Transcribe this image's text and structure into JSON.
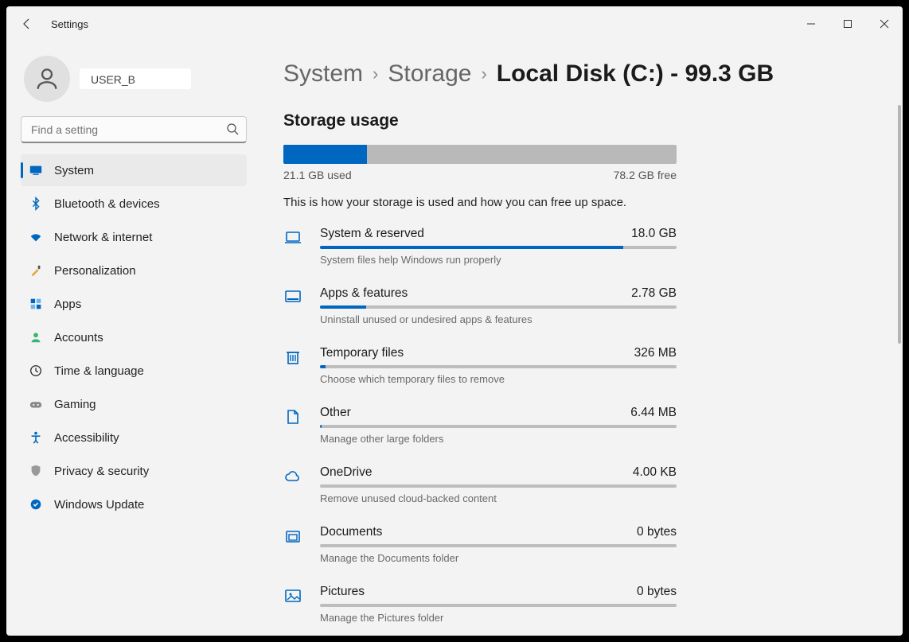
{
  "app_title": "Settings",
  "user": {
    "name": "USER_B"
  },
  "search": {
    "placeholder": "Find a setting"
  },
  "nav": {
    "items": [
      {
        "label": "System",
        "icon": "system",
        "selected": true
      },
      {
        "label": "Bluetooth & devices",
        "icon": "bluetooth"
      },
      {
        "label": "Network & internet",
        "icon": "wifi"
      },
      {
        "label": "Personalization",
        "icon": "brush"
      },
      {
        "label": "Apps",
        "icon": "apps"
      },
      {
        "label": "Accounts",
        "icon": "account"
      },
      {
        "label": "Time & language",
        "icon": "time"
      },
      {
        "label": "Gaming",
        "icon": "gaming"
      },
      {
        "label": "Accessibility",
        "icon": "accessibility"
      },
      {
        "label": "Privacy & security",
        "icon": "shield"
      },
      {
        "label": "Windows Update",
        "icon": "update"
      }
    ]
  },
  "breadcrumb": {
    "root": "System",
    "mid": "Storage",
    "current": "Local Disk (C:) - 99.3 GB"
  },
  "storage": {
    "section_title": "Storage usage",
    "used_label": "21.1 GB used",
    "free_label": "78.2 GB free",
    "used_pct": 21.2,
    "description": "This is how your storage is used and how you can free up space."
  },
  "categories": [
    {
      "name": "System & reserved",
      "size": "18.0 GB",
      "desc": "System files help Windows run properly",
      "pct": 85,
      "icon": "laptop"
    },
    {
      "name": "Apps & features",
      "size": "2.78 GB",
      "desc": "Uninstall unused or undesired apps & features",
      "pct": 13,
      "icon": "apps2"
    },
    {
      "name": "Temporary files",
      "size": "326 MB",
      "desc": "Choose which temporary files to remove",
      "pct": 1.5,
      "icon": "trash"
    },
    {
      "name": "Other",
      "size": "6.44 MB",
      "desc": "Manage other large folders",
      "pct": 0.5,
      "icon": "other"
    },
    {
      "name": "OneDrive",
      "size": "4.00 KB",
      "desc": "Remove unused cloud-backed content",
      "pct": 0,
      "icon": "cloud"
    },
    {
      "name": "Documents",
      "size": "0 bytes",
      "desc": "Manage the Documents folder",
      "pct": 0,
      "icon": "docs"
    },
    {
      "name": "Pictures",
      "size": "0 bytes",
      "desc": "Manage the Pictures folder",
      "pct": 0,
      "icon": "pictures"
    }
  ]
}
